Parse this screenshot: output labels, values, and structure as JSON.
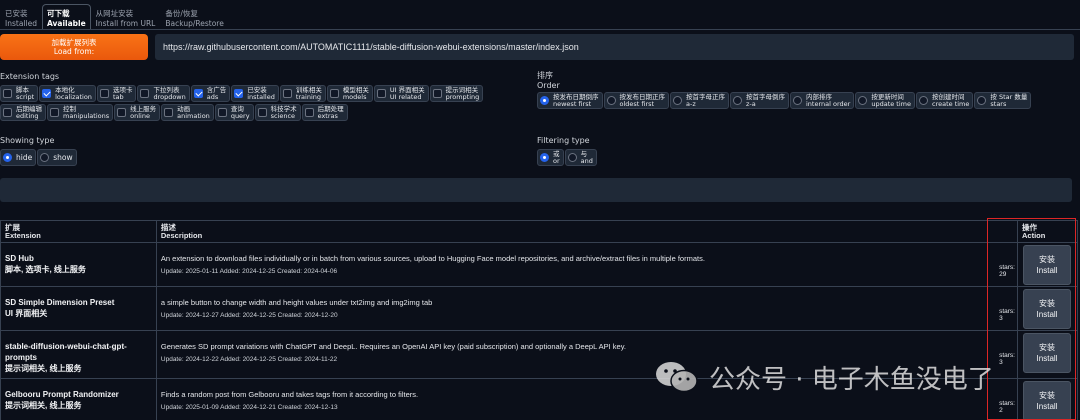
{
  "tabs": [
    {
      "zh": "已安装",
      "en": "Installed",
      "active": false
    },
    {
      "zh": "可下载",
      "en": "Available",
      "active": true
    },
    {
      "zh": "从网址安装",
      "en": "Install from URL",
      "active": false
    },
    {
      "zh": "备份/恢复",
      "en": "Backup/Restore",
      "active": false
    }
  ],
  "load_button": {
    "zh": "加载扩展列表",
    "en": "Load from:"
  },
  "url_value": "https://raw.githubusercontent.com/AUTOMATIC1111/stable-diffusion-webui-extensions/master/index.json",
  "extension_tags": {
    "label": "Extension tags",
    "items": [
      {
        "zh": "脚本",
        "en": "script",
        "checked": false
      },
      {
        "zh": "本地化",
        "en": "localization",
        "checked": true
      },
      {
        "zh": "选项卡",
        "en": "tab",
        "checked": false
      },
      {
        "zh": "下拉列表",
        "en": "dropdown",
        "checked": false
      },
      {
        "zh": "含广告",
        "en": "ads",
        "checked": true
      },
      {
        "zh": "已安装",
        "en": "installed",
        "checked": true
      },
      {
        "zh": "训练相关",
        "en": "training",
        "checked": false
      },
      {
        "zh": "模型相关",
        "en": "models",
        "checked": false
      },
      {
        "zh": "UI 界面相关",
        "en": "UI related",
        "checked": false
      },
      {
        "zh": "提示词相关",
        "en": "prompting",
        "checked": false
      },
      {
        "zh": "后期编辑",
        "en": "editing",
        "checked": false
      },
      {
        "zh": "控制",
        "en": "manipulations",
        "checked": false
      },
      {
        "zh": "线上服务",
        "en": "online",
        "checked": false
      },
      {
        "zh": "动画",
        "en": "animation",
        "checked": false
      },
      {
        "zh": "查询",
        "en": "query",
        "checked": false
      },
      {
        "zh": "科技学术",
        "en": "science",
        "checked": false
      },
      {
        "zh": "后期处理",
        "en": "extras",
        "checked": false
      }
    ]
  },
  "order": {
    "label_zh": "排序",
    "label_en": "Order",
    "items": [
      {
        "zh": "按发布日期倒序",
        "en": "newest first",
        "selected": true
      },
      {
        "zh": "按发布日期正序",
        "en": "oldest first",
        "selected": false
      },
      {
        "zh": "按首字母正序",
        "en": "a-z",
        "selected": false
      },
      {
        "zh": "按首字母倒序",
        "en": "z-a",
        "selected": false
      },
      {
        "zh": "内部排序",
        "en": "internal order",
        "selected": false
      },
      {
        "zh": "按更新时间",
        "en": "update time",
        "selected": false
      },
      {
        "zh": "按创建时间",
        "en": "create time",
        "selected": false
      },
      {
        "zh": "按 Star 数量",
        "en": "stars",
        "selected": false
      }
    ]
  },
  "showing_type": {
    "label": "Showing type",
    "items": [
      {
        "label": "hide",
        "selected": true
      },
      {
        "label": "show",
        "selected": false
      }
    ]
  },
  "filtering_type": {
    "label": "Filtering type",
    "items": [
      {
        "zh": "或",
        "en": "or",
        "selected": true
      },
      {
        "zh": "与",
        "en": "and",
        "selected": false
      }
    ]
  },
  "table": {
    "headers": [
      {
        "zh": "扩展",
        "en": "Extension"
      },
      {
        "zh": "描述",
        "en": "Description"
      },
      {
        "zh": "操作",
        "en": "Action"
      }
    ],
    "rows": [
      {
        "name": "SD Hub",
        "tags": "脚本, 选项卡, 线上服务",
        "description": "An extension to download files individually or in batch from various sources, upload to Hugging Face model repositories, and archive/extract files in multiple formats.",
        "dates": "Update: 2025-01-11 Added: 2024-12-25 Created: 2024-04-06",
        "stars": "stars: 29",
        "install_zh": "安装",
        "install_en": "Install"
      },
      {
        "name": "SD Simple Dimension Preset",
        "tags": "UI 界面相关",
        "description": "a simple button to change width and height values under txt2img and img2img tab",
        "dates": "Update: 2024-12-27 Added: 2024-12-25 Created: 2024-12-20",
        "stars": "stars: 3",
        "install_zh": "安装",
        "install_en": "Install"
      },
      {
        "name": "stable-diffusion-webui-chat-gpt-prompts",
        "tags": "提示词相关, 线上服务",
        "description": "Generates SD prompt variations with ChatGPT and DeepL. Requires an OpenAI API key (paid subscription) and optionally a DeepL API key.",
        "dates": "Update: 2024-12-22 Added: 2024-12-25 Created: 2024-11-22",
        "stars": "stars: 3",
        "install_zh": "安装",
        "install_en": "Install"
      },
      {
        "name": "Gelbooru Prompt Randomizer",
        "tags": "提示词相关, 线上服务",
        "description": "Finds a random post from Gelbooru and takes tags from it according to filters.",
        "dates": "Update: 2025-01-09 Added: 2024-12-21 Created: 2024-12-13",
        "stars": "stars: 2",
        "install_zh": "安装",
        "install_en": "Install"
      }
    ]
  },
  "watermark": "公众号 · 电子木鱼没电了",
  "colors": {
    "background": "#0b0f19",
    "accent_orange": "#f97316",
    "checkbox_blue": "#2563eb",
    "highlight_red": "#dc2626"
  }
}
